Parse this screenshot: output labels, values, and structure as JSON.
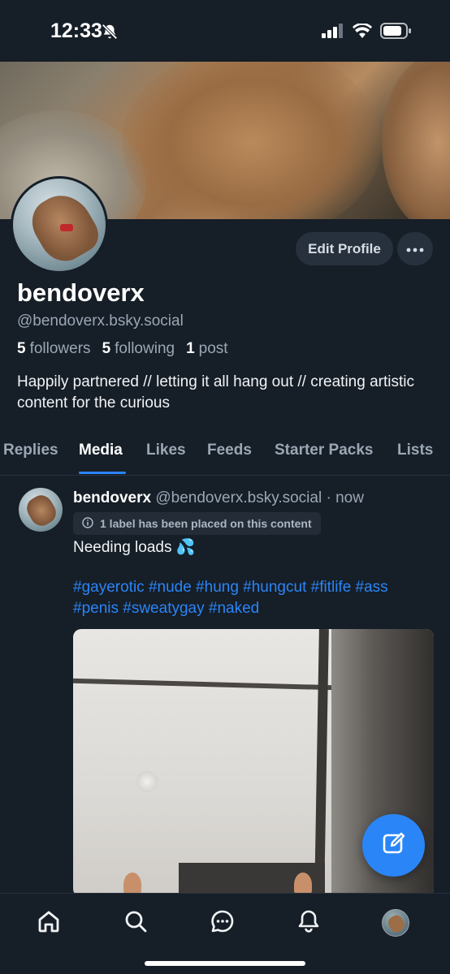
{
  "status_bar": {
    "time": "12:33"
  },
  "profile": {
    "display_name": "bendoverx",
    "handle": "@bendoverx.bsky.social",
    "followers_count": "5",
    "followers_label": "followers",
    "following_count": "5",
    "following_label": "following",
    "posts_count": "1",
    "posts_label": "post",
    "bio": "Happily partnered // letting it all hang out // creating artistic content for the curious",
    "edit_button_label": "Edit Profile"
  },
  "tabs": [
    {
      "label": "Replies"
    },
    {
      "label": "Media"
    },
    {
      "label": "Likes"
    },
    {
      "label": "Feeds"
    },
    {
      "label": "Starter Packs"
    },
    {
      "label": "Lists"
    }
  ],
  "post": {
    "author": "bendoverx",
    "handle": "@bendoverx.bsky.social",
    "separator": "·",
    "time": "now",
    "label_notice": "1 label has been placed on this content",
    "text": "Needing loads 💦",
    "hashtags": "#gayerotic #nude #hung #hungcut #fitlife #ass #penis #sweatygay #naked"
  },
  "colors": {
    "background": "#161e27",
    "accent": "#2a85f7",
    "muted_text": "#9aa7b5"
  },
  "icons": [
    "bell-slash-icon",
    "signal-icon",
    "wifi-icon",
    "battery-icon",
    "more-icon",
    "info-icon",
    "compose-icon",
    "home-icon",
    "search-icon",
    "chat-icon",
    "bell-icon"
  ]
}
